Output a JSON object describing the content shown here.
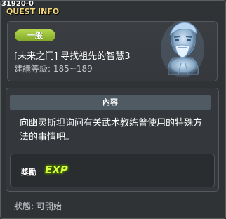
{
  "window": {
    "quest_id": "31920-0",
    "title": "QUEST INFO"
  },
  "quest": {
    "category": "一般",
    "name": "[未来之门] 寻找祖先的智慧3",
    "level_range": "建議等級: 185~189"
  },
  "content": {
    "header": "內容",
    "description": "向幽灵斯坦询问有关武术教练曾使用的特殊方法的事情吧。"
  },
  "reward": {
    "label": "獎勵",
    "exp_text": "EXP"
  },
  "status": {
    "text": "狀態: 可開始"
  },
  "colors": {
    "badge": "#9cc43a",
    "title": "#f6d97a",
    "exp": "#d4ff3a"
  },
  "icons": {
    "npc": "ghost-npc-portrait-icon",
    "exp": "exp-icon"
  }
}
